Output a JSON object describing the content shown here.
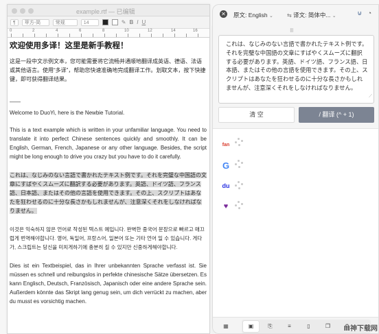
{
  "editor": {
    "window_title": "example.rtf — 已编辑",
    "format_bar": {
      "style": "¶",
      "font": "苹方-简",
      "weight": "常规",
      "size": "14"
    },
    "ruler_numbers": [
      "0",
      "2",
      "4",
      "6",
      "8",
      "10",
      "12",
      "14",
      "16"
    ],
    "heading": "欢迎使用多译！这里是新手教程！",
    "para_zh": "这是一段中文示例文本，您可能需要将它流畅并通顺地翻译成英语、德语、法语或其他语言。使用“多译”，帮助您快速准确地完成翻译工作。划取文本，按下快捷键，即可获得翻译结果。",
    "separator": "——",
    "para_en1": "Welcome to DuoYi, here is the Newbie Tutorial.",
    "para_en2": "This is a text example which is written in your unfamiliar language. You need to translate it into perfect Chinese sentences quickly and smoothly. It can be English, German, French, Japanese or any other language. Besides, the script might be long enough to drive you crazy but you have to do it carefully.",
    "para_ja": "これは、なじみのない言語で書かれたテキスト例です。それを完璧な中国語の文章にすばやくスムーズに翻訳する必要があります。英語、ドイツ語、フランス語、日本語、またはその他の言語を使用できます。その上、スクリプトはあなたを狂わせるのに十分な長さかもしれませんが、注意深くそれをしなければなりません。",
    "para_ko": "이것은 익숙하지 않은 언어로 작성된 텍스트 예입니다. 완벽한 중국어 문장으로 빠르고 매끄럽게 번역해야합니다. 영어, 독일어, 프랑스어, 일본어 또는 기타 언어 일 수 있습니다. 게다가, 스크립트는 당신을 미치게하기에 충분히 길 수 있지만 신중하게해야합니다.",
    "para_de": "Dies ist ein Textbeispiel, das in Ihrer unbekannten Sprache verfasst ist. Sie müssen es schnell und reibungslos in perfekte chinesische Sätze übersetzen. Es kann Englisch, Deutsch, Französisch, Japanisch oder eine andere Sprache sein. Außerdem könnte das Skript lang genug sein, um dich verrückt zu machen, aber du musst es vorsichtig machen."
  },
  "panel": {
    "source_label": "原文:",
    "source_lang": "English",
    "target_label": "译文:",
    "target_lang": "简体中...",
    "source_text": "これは、なじみのない言語で書かれたテキスト例です。それを完璧な中国語の文章にすばやくスムーズに翻訳する必要があります。英語、ドイツ語、フランス語、日本語、またはその他の言語を使用できます。その上、スクリプトはあなたを狂わせるのに十分な長さかもしれませんが、注意深くそれをしなければなりません。",
    "clear_label": "清 空",
    "translate_label": "/ 翻译 (^ + 1)",
    "engines": [
      {
        "name": "fanyi",
        "mark": "fan",
        "color": "#d93a2b"
      },
      {
        "name": "google",
        "mark": "G",
        "color": "#4285f4"
      },
      {
        "name": "baidu",
        "mark": "du",
        "color": "#2932e1"
      },
      {
        "name": "heart",
        "mark": "♥",
        "color": "#7a2b9a"
      }
    ]
  },
  "watermark": "Ⅲ神下载网"
}
